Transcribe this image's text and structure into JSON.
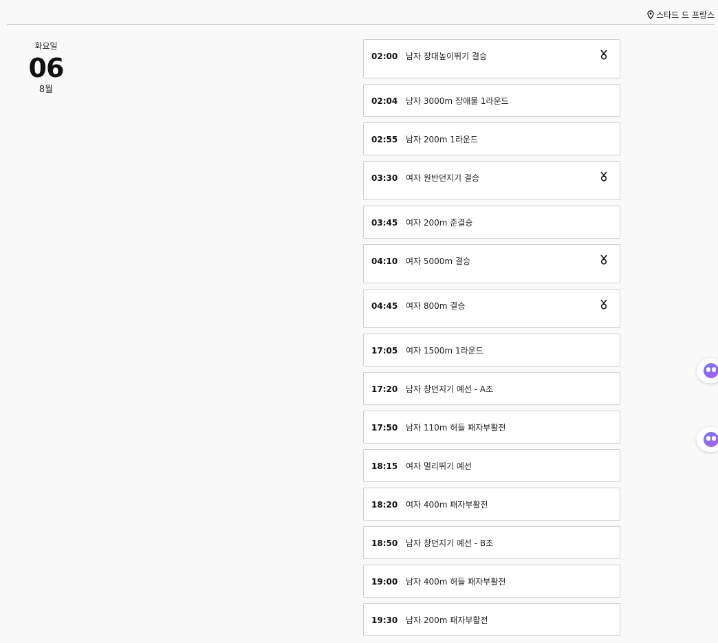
{
  "header": {
    "venue_icon": "location-pin-icon",
    "venue": "스타드 드 프랑스"
  },
  "date": {
    "weekday": "화요일",
    "day": "06",
    "month": "8월"
  },
  "events": [
    {
      "time": "02:00",
      "name": "남자 장대높이뛰기 결승",
      "medal": true
    },
    {
      "time": "02:04",
      "name": "남자 3000m 장애물 1라운드",
      "medal": false
    },
    {
      "time": "02:55",
      "name": "남자 200m 1라운드",
      "medal": false
    },
    {
      "time": "03:30",
      "name": "여자 원반던지기 결승",
      "medal": true
    },
    {
      "time": "03:45",
      "name": "여자 200m 준결승",
      "medal": false
    },
    {
      "time": "04:10",
      "name": "여자 5000m 결승",
      "medal": true
    },
    {
      "time": "04:45",
      "name": "여자 800m 결승",
      "medal": true
    },
    {
      "time": "17:05",
      "name": "여자 1500m 1라운드",
      "medal": false
    },
    {
      "time": "17:20",
      "name": "남자 창던지기 예선 - A조",
      "medal": false
    },
    {
      "time": "17:50",
      "name": "남자 110m 허들 패자부활전",
      "medal": false
    },
    {
      "time": "18:15",
      "name": "여자 멀리뛰기 예선",
      "medal": false
    },
    {
      "time": "18:20",
      "name": "여자 400m 패자부활전",
      "medal": false
    },
    {
      "time": "18:50",
      "name": "남자 창던지기 예선 - B조",
      "medal": false
    },
    {
      "time": "19:00",
      "name": "남자 400m 허들 패자부활전",
      "medal": false
    },
    {
      "time": "19:30",
      "name": "남자 200m 패자부활전",
      "medal": false
    }
  ],
  "icons": {
    "medal": "medal-icon",
    "assistant": "chatbot-icon"
  }
}
